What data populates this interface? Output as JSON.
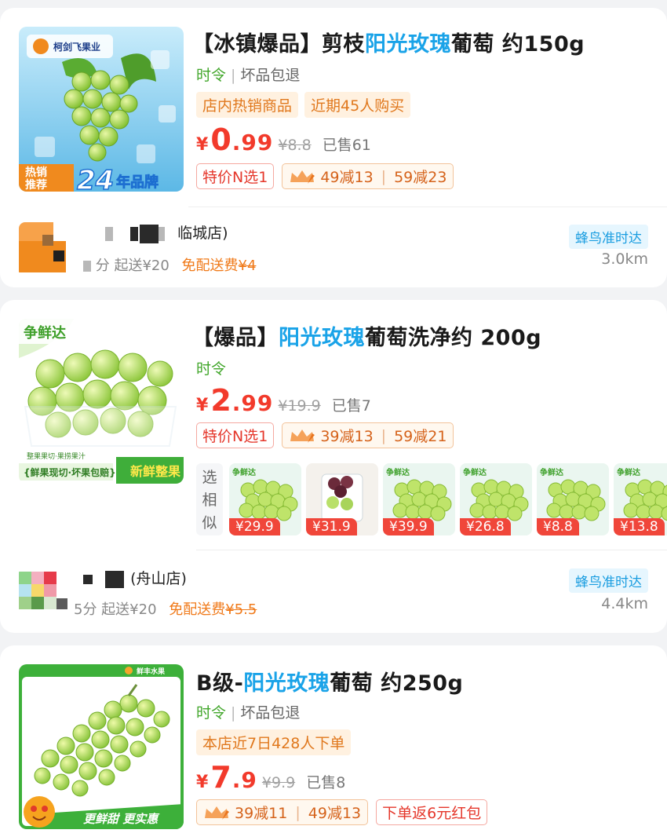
{
  "colors": {
    "accent_blue": "#1aa3e8",
    "price_red": "#f23a2b",
    "green": "#41a62a",
    "orange": "#e0781d"
  },
  "products": [
    {
      "thumb_icon": "grape-bunch-ice-image",
      "thumb_brand": "柯剑飞果业",
      "thumb_badge_top": "热销",
      "thumb_badge_bottom": "推荐",
      "thumb_big": "24",
      "thumb_big_suffix": "年品牌",
      "title_pre": "【冰镇爆品】剪枝",
      "title_hl": "阳光玫瑰",
      "title_post": "葡萄 约150g",
      "season": "时令",
      "guarantee": "坏品包退",
      "tags": [
        "店内热销商品",
        "近期45人购买"
      ],
      "yen": "¥",
      "price_int": "0",
      "price_dec": ".99",
      "orig_price": "¥8.8",
      "sold": "已售61",
      "promo_label": "特价N选1",
      "deal_a": "49减13",
      "deal_b": "59减23",
      "store_name_suffix": "临城店)",
      "store_sub_prefix": "分 起送¥20",
      "free_delivery": "免配送费",
      "delivery_fee": "¥4",
      "delivery_badge": "蜂鸟准时达",
      "distance": "3.0km"
    },
    {
      "thumb_icon": "grape-box-image",
      "thumb_brand": "争鲜达",
      "thumb_small_text": "整果果切·果捞果汁",
      "thumb_left_text": "{鲜果现切·坏果包赔}",
      "thumb_right_text": "新鲜整果",
      "title_pre": "【爆品】",
      "title_hl": "阳光玫瑰",
      "title_post": "葡萄洗净约 200g",
      "season": "时令",
      "yen": "¥",
      "price_int": "2",
      "price_dec": ".99",
      "orig_price": "¥19.9",
      "sold": "已售7",
      "promo_label": "特价N选1",
      "deal_a": "39减13",
      "deal_b": "59减21",
      "similar_label": "选相似",
      "similar": [
        {
          "price": "¥29.9",
          "brand": "争鲜达",
          "icon": "green-grapes-image"
        },
        {
          "price": "¥31.9",
          "brand": "",
          "icon": "red-green-grapes-cup-image"
        },
        {
          "price": "¥39.9",
          "brand": "争鲜达",
          "icon": "green-grapes-box-image"
        },
        {
          "price": "¥26.8",
          "brand": "争鲜达",
          "icon": "green-grapes-box-image"
        },
        {
          "price": "¥8.8",
          "brand": "争鲜达",
          "icon": "green-grapes-box-image"
        },
        {
          "price": "¥13.8",
          "brand": "争鲜达",
          "icon": "green-grapes-box-image"
        }
      ],
      "store_name_suffix": "(舟山店)",
      "store_sub_prefix": "5分 起送¥20",
      "free_delivery": "免配送费",
      "delivery_fee": "¥5.5",
      "delivery_badge": "蜂鸟准时达",
      "distance": "4.4km"
    },
    {
      "thumb_icon": "grape-bunch-image",
      "thumb_corner": "鲜丰水果",
      "thumb_slogan": "更鲜甜 更实惠",
      "title_pre": "B级-",
      "title_hl": "阳光玫瑰",
      "title_post": "葡萄 约250g",
      "season": "时令",
      "guarantee": "坏品包退",
      "tags": [
        "本店近7日428人下单"
      ],
      "yen": "¥",
      "price_int": "7",
      "price_dec": ".9",
      "orig_price": "¥9.9",
      "sold": "已售8",
      "deal_a": "39减11",
      "deal_b": "49减13",
      "promo_extra": "下单返6元红包"
    }
  ]
}
